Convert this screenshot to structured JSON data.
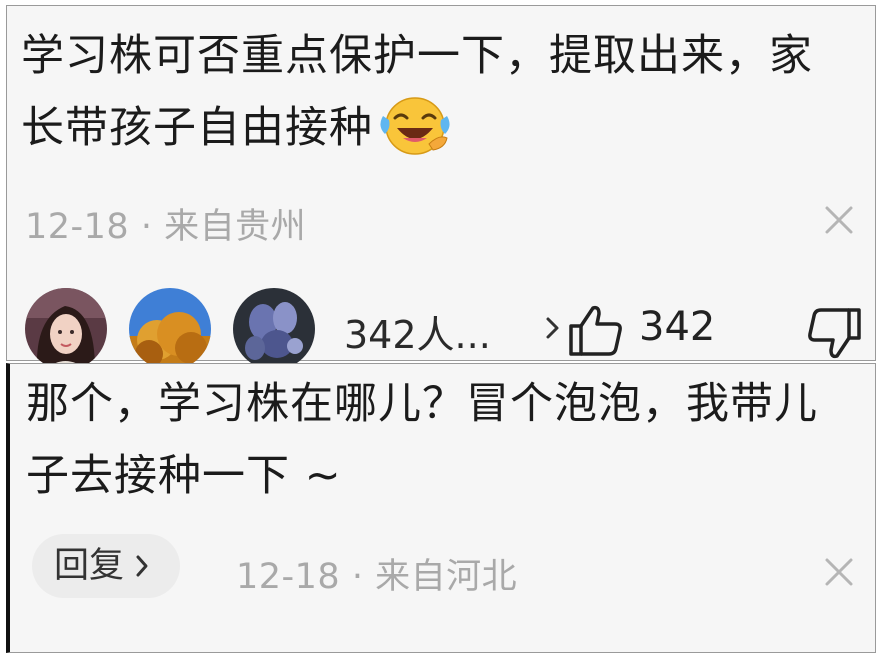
{
  "comment1": {
    "text": "学习株可否重点保护一下，提取出来，家长带孩子自由接种",
    "emoji": "laughing-crying-emoji",
    "meta": "12-18 · 来自贵州",
    "likers_text": "342人...",
    "like_count": "342"
  },
  "comment2": {
    "text": "那个，学习株在哪儿？冒个泡泡，我带儿子去接种一下 ~",
    "reply_label": "回复",
    "meta": "12-18 · 来自河北"
  },
  "colors": {
    "panel_bg": "#f6f6f6",
    "meta_text": "#a9a9a9",
    "reply_bg": "#ececec"
  }
}
